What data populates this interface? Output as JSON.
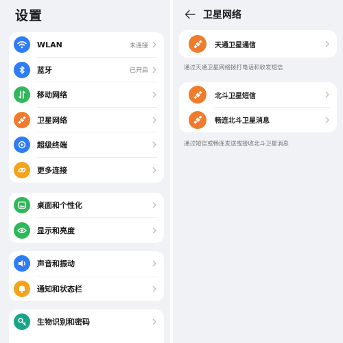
{
  "settings": {
    "title": "设置",
    "items": [
      {
        "label": "WLAN",
        "status": "未连接",
        "color": "#2f7df6",
        "icon": "wifi-icon"
      },
      {
        "label": "蓝牙",
        "status": "已开启",
        "color": "#2f7df6",
        "icon": "bluetooth-icon"
      },
      {
        "label": "移动网络",
        "status": "",
        "color": "#30b75a",
        "icon": "mobile-network-icon"
      },
      {
        "label": "卫星网络",
        "status": "",
        "color": "#f07b2c",
        "icon": "satellite-icon"
      },
      {
        "label": "超级终端",
        "status": "",
        "color": "#2f7df6",
        "icon": "super-device-icon"
      },
      {
        "label": "更多连接",
        "status": "",
        "color": "#f5a31a",
        "icon": "link-icon"
      },
      {
        "label": "桌面和个性化",
        "status": "",
        "color": "#30b75a",
        "icon": "desktop-icon"
      },
      {
        "label": "显示和亮度",
        "status": "",
        "color": "#30b75a",
        "icon": "eye-icon"
      },
      {
        "label": "声音和振动",
        "status": "",
        "color": "#2f7df6",
        "icon": "speaker-icon"
      },
      {
        "label": "通知和状态栏",
        "status": "",
        "color": "#f5a31a",
        "icon": "bell-icon"
      },
      {
        "label": "生物识别和密码",
        "status": "",
        "color": "#17a589",
        "icon": "key-icon"
      }
    ]
  },
  "satellite": {
    "title": "卫星网络",
    "tiantong": {
      "label": "天通卫星通信",
      "note": "通过天通卫星网络拨打电话和收发短信",
      "color": "#f07b2c",
      "icon": "satellite-icon"
    },
    "beidou": [
      {
        "label": "北斗卫星短信",
        "color": "#f07b2c",
        "icon": "satellite-icon"
      },
      {
        "label": "畅连北斗卫星消息",
        "color": "#f07b2c",
        "icon": "satellite-icon"
      }
    ],
    "beidou_note": "通过短信或畅连发送或接收北斗卫星消息"
  }
}
